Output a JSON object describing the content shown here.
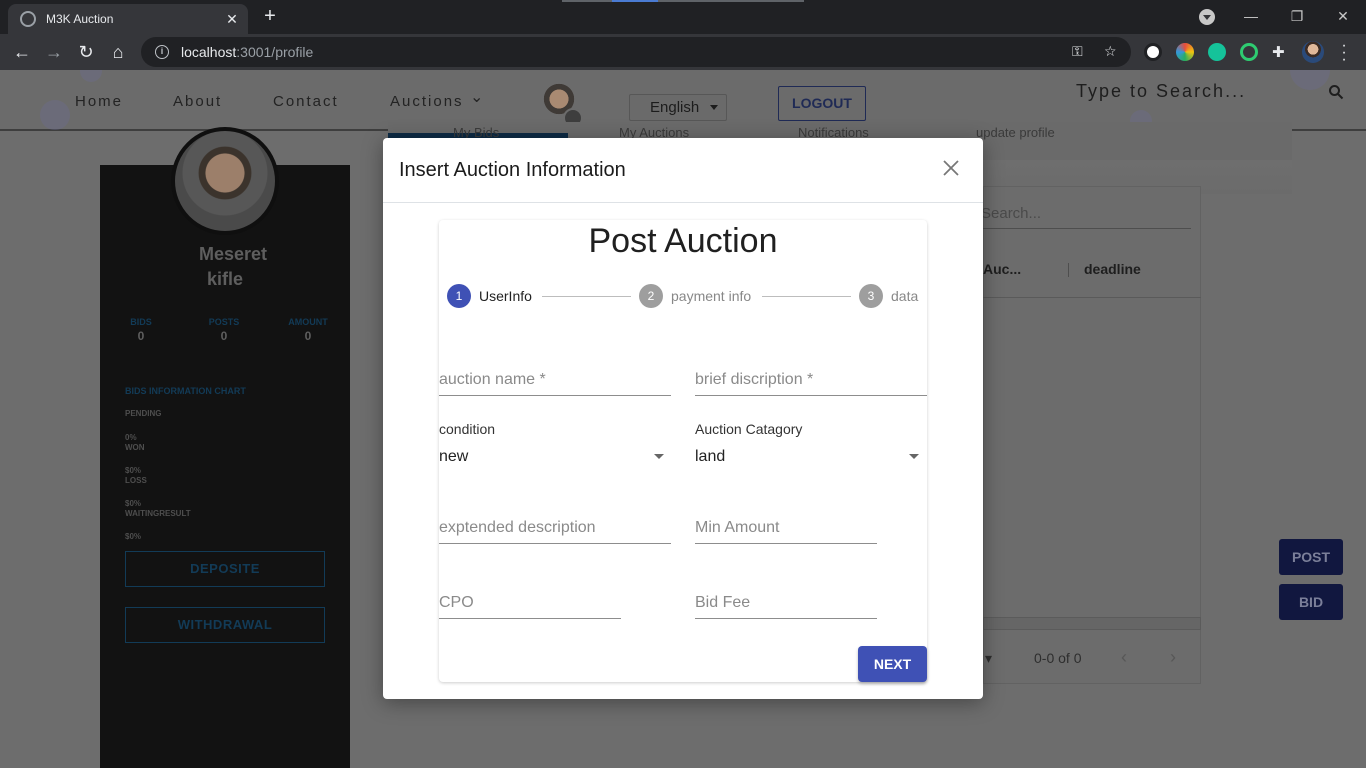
{
  "browser": {
    "tab_title": "M3K Auction",
    "tab_close": "✕",
    "new_tab": "+",
    "url_host": "localhost",
    "url_path": ":3001/profile",
    "win_min": "—",
    "win_restore": "❐",
    "win_close": "✕"
  },
  "nav": {
    "home": "Home",
    "about": "About",
    "contact": "Contact",
    "auctions": "Auctions",
    "language": "English",
    "logout": "LOGOUT",
    "search_placeholder": "Type to Search..."
  },
  "profile": {
    "first_name": "Meseret",
    "last_name": "kifle",
    "stats": [
      {
        "label": "BIDS",
        "value": "0"
      },
      {
        "label": "POSTS",
        "value": "0"
      },
      {
        "label": "AMOUNT",
        "value": "0"
      }
    ],
    "chart_title": "BIDS INFORMATION CHART",
    "chart_rows": [
      "PENDING",
      "0%",
      "WON",
      "$0%",
      "LOSS",
      "$0%",
      "WAITINGRESULT",
      "$0%"
    ],
    "deposite": "DEPOSITE",
    "withdrawal": "WITHDRAWAL"
  },
  "tabs": [
    "My Bids",
    "My Auctions",
    "Notifications",
    "update profile"
  ],
  "table": {
    "search_placeholder": "Search...",
    "col_a": "Auc...",
    "col_b": "deadline",
    "pager": "0-0 of 0"
  },
  "fabs": {
    "post": "POST",
    "bid": "BID"
  },
  "modal": {
    "title": "Insert Auction Information",
    "card_title": "Post Auction",
    "steps": [
      {
        "num": "1",
        "label": "UserInfo",
        "active": true
      },
      {
        "num": "2",
        "label": "payment info",
        "active": false
      },
      {
        "num": "3",
        "label": "data",
        "active": false
      }
    ],
    "fields": {
      "auction_name": "auction name *",
      "brief_description": "brief discription *",
      "condition_label": "condition",
      "condition_value": "new",
      "category_label": "Auction Catagory",
      "category_value": "land",
      "extended_description": "exptended description",
      "min_amount": "Min Amount",
      "cpo": "CPO",
      "bid_fee": "Bid Fee"
    },
    "next": "NEXT"
  },
  "colors": {
    "primary": "#3f51b5",
    "step_inactive": "#9e9e9e",
    "overlay_dim": "#6d6d6d"
  }
}
